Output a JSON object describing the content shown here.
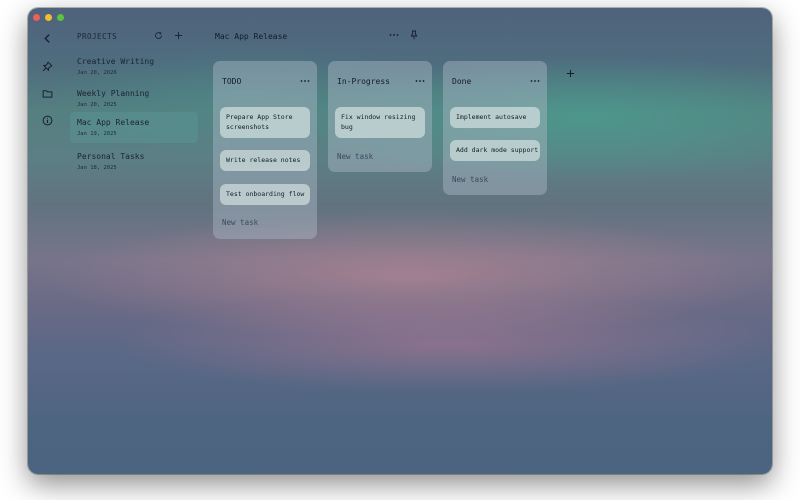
{
  "window": {
    "controls": [
      "close",
      "minimize",
      "zoom"
    ]
  },
  "nav_rail": {
    "icons": [
      "chevron-left-icon",
      "pin-icon",
      "folder-icon",
      "info-icon"
    ]
  },
  "sidebar": {
    "header": "PROJECTS",
    "projects": [
      {
        "name": "Creative Writing",
        "date": "Jan 20, 2026"
      },
      {
        "name": "Weekly Planning",
        "date": "Jan 20, 2025"
      },
      {
        "name": "Mac App Release",
        "date": "Jan 19, 2025",
        "active": true
      },
      {
        "name": "Personal Tasks",
        "date": "Jan 18, 2025"
      }
    ]
  },
  "board": {
    "title": "Mac App Release",
    "columns": [
      {
        "title": "TODO",
        "cards": [
          "Prepare App Store screenshots",
          "Write release notes",
          "Test onboarding flow"
        ],
        "new_task_placeholder": "New task"
      },
      {
        "title": "In-Progress",
        "cards": [
          "Fix window resizing bug"
        ],
        "new_task_placeholder": "New task"
      },
      {
        "title": "Done",
        "cards": [
          "Implement autosave",
          "Add dark mode support"
        ],
        "new_task_placeholder": "New task"
      }
    ]
  },
  "colors": {
    "close": "#ed5f57",
    "minimize": "#f2bd30",
    "zoom": "#5bc43c",
    "active_project": "#5a9696"
  }
}
